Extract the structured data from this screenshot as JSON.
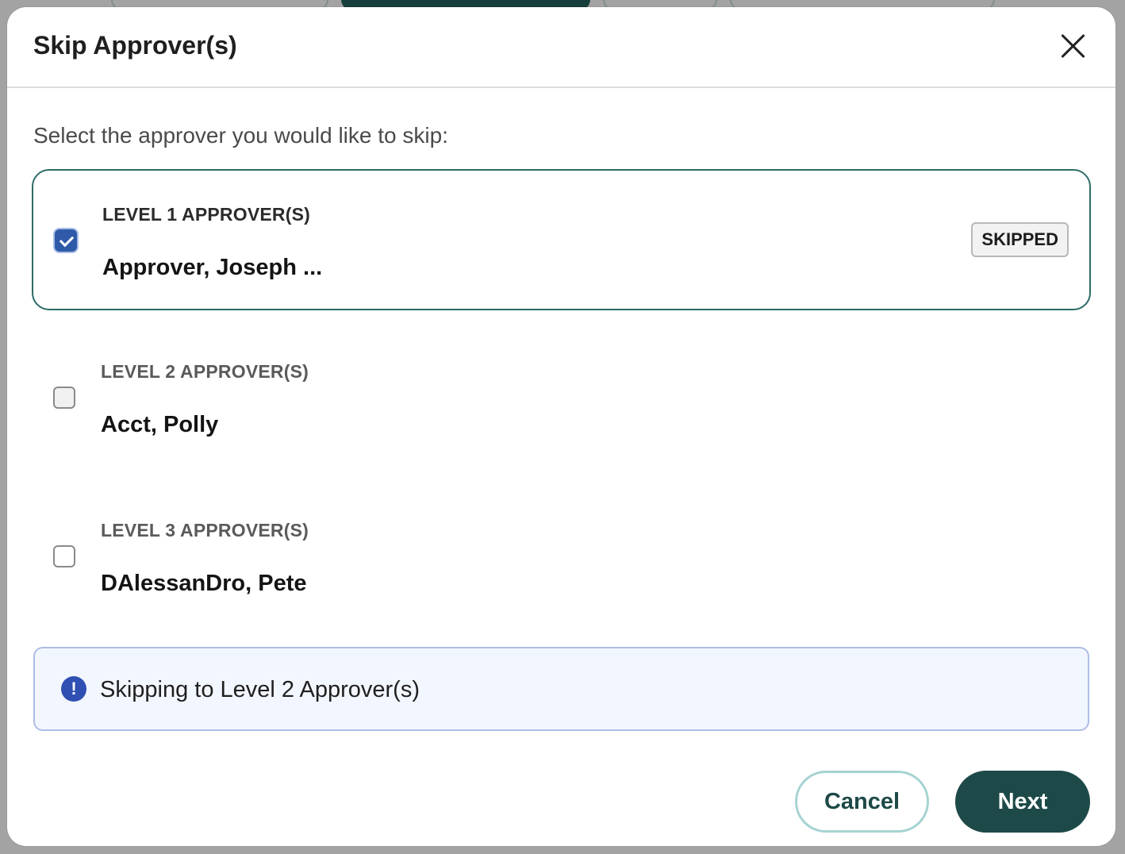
{
  "modal": {
    "title": "Skip Approver(s)",
    "instruction": "Select the approver you would like to skip:",
    "levels": [
      {
        "label": "LEVEL 1 APPROVER(S)",
        "approver": "Approver, Joseph ...",
        "checked": true,
        "badge": "SKIPPED"
      },
      {
        "label": "LEVEL 2 APPROVER(S)",
        "approver": "Acct, Polly",
        "checked": false
      },
      {
        "label": "LEVEL 3 APPROVER(S)",
        "approver": "DAlessanDro, Pete",
        "checked": false
      }
    ],
    "info": {
      "icon": "!",
      "text": "Skipping to Level 2 Approver(s)"
    },
    "buttons": {
      "cancel": "Cancel",
      "next": "Next"
    }
  },
  "colors": {
    "accent": "#1d4a48",
    "checkbox_checked": "#2f5aa8",
    "info_background": "#f2f6fe",
    "info_icon": "#2f4fb2"
  }
}
